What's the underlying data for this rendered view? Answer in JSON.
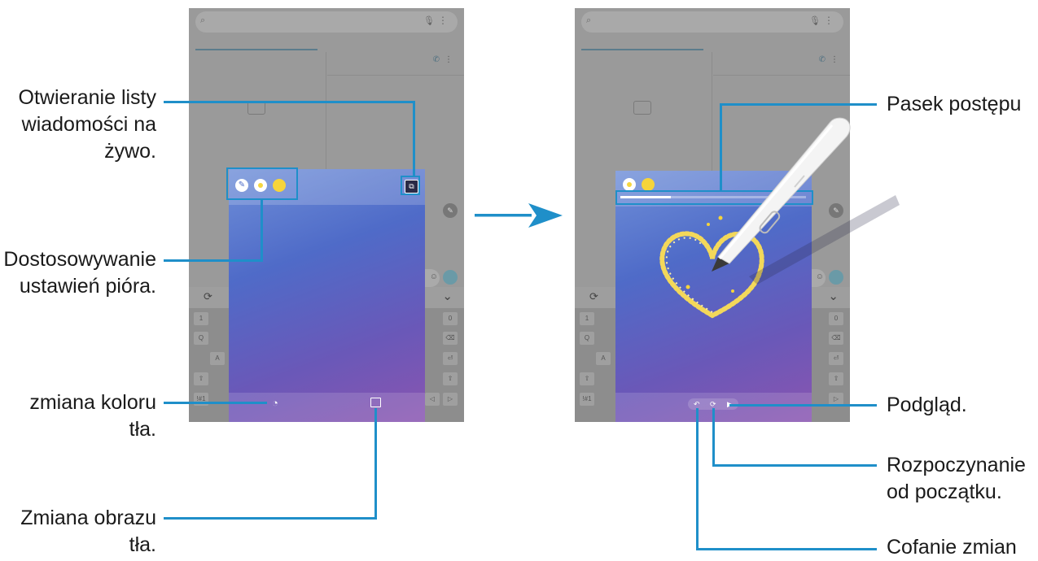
{
  "callouts": {
    "live_list": "Otwieranie listy wiadomości na żywo.",
    "pen_settings": "Dostosowywanie ustawień pióra.",
    "bg_color": "zmiana koloru tła.",
    "bg_image": "Zmiana obrazu tła.",
    "progress_bar": "Pasek postępu",
    "preview": "Podgląd.",
    "restart": "Rozpoczynanie od początku.",
    "undo": "Cofanie zmian"
  },
  "progress": {
    "fraction": 0.27
  },
  "colors": {
    "accent": "#1f8fc9",
    "pen_yellow": "#f6d43a",
    "panel_top": "#6f8fd8",
    "panel_bottom": "#8a55b0"
  },
  "icons": {
    "arrow": "blue-right-arrow-icon",
    "pen_settings": "paint-brush-icon",
    "live_list": "stacked-messages-icon",
    "bg_color": "palette-icon",
    "bg_image": "image-icon",
    "undo": "undo-icon",
    "restart": "refresh-icon",
    "preview": "play-icon",
    "spen": "s-pen-icon",
    "heart": "heart-drawing-icon"
  }
}
